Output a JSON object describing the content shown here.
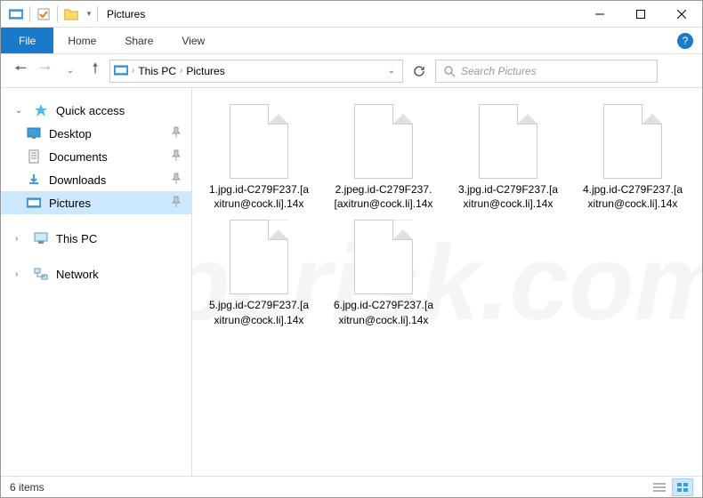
{
  "window": {
    "title": "Pictures"
  },
  "ribbon": {
    "file": "File",
    "tabs": [
      "Home",
      "Share",
      "View"
    ]
  },
  "nav": {
    "breadcrumb": [
      "This PC",
      "Pictures"
    ],
    "search_placeholder": "Search Pictures"
  },
  "sidebar": {
    "quick_access": "Quick access",
    "pinned": [
      {
        "label": "Desktop",
        "icon": "desktop"
      },
      {
        "label": "Documents",
        "icon": "documents"
      },
      {
        "label": "Downloads",
        "icon": "downloads"
      },
      {
        "label": "Pictures",
        "icon": "pictures",
        "selected": true
      }
    ],
    "this_pc": "This PC",
    "network": "Network"
  },
  "files": [
    {
      "name": "1.jpg.id-C279F237.[axitrun@cock.li].14x"
    },
    {
      "name": "2.jpeg.id-C279F237.[axitrun@cock.li].14x"
    },
    {
      "name": "3.jpg.id-C279F237.[axitrun@cock.li].14x"
    },
    {
      "name": "4.jpg.id-C279F237.[axitrun@cock.li].14x"
    },
    {
      "name": "5.jpg.id-C279F237.[axitrun@cock.li].14x"
    },
    {
      "name": "6.jpg.id-C279F237.[axitrun@cock.li].14x"
    }
  ],
  "status": {
    "count": "6 items"
  },
  "watermark": "pcrisk.com"
}
